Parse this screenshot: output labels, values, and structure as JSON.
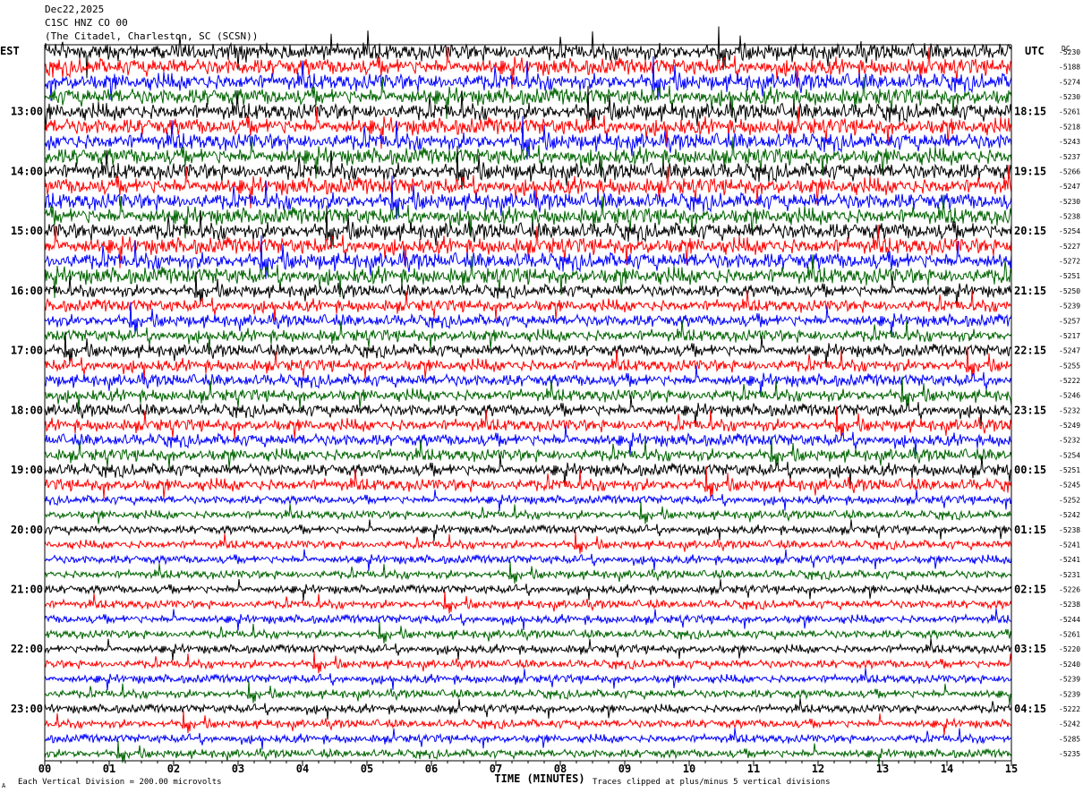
{
  "header": {
    "date": "Dec22,2025",
    "station": "C1SC HNZ CO 00",
    "network": "(The Citadel, Charleston, SC (SCSN))"
  },
  "footer": {
    "scale_note": "Each Vertical Division =  200.00 microvolts",
    "clip_note": "Traces clipped at plus/minus 5 vertical divisions",
    "corner_mark": "A"
  },
  "chart_data": {
    "type": "line",
    "title": "",
    "xlabel": "TIME (MINUTES)",
    "x_ticks": [
      "00",
      "01",
      "02",
      "03",
      "04",
      "05",
      "06",
      "07",
      "08",
      "09",
      "10",
      "11",
      "12",
      "13",
      "14",
      "15"
    ],
    "xlim": [
      0,
      15
    ],
    "left_axis_label": "EST",
    "right_axis_label": "UTC",
    "dc_label": "DC",
    "left_hour_labels": [
      "13:00",
      "14:00",
      "15:00",
      "16:00",
      "17:00",
      "18:00",
      "19:00",
      "20:00",
      "21:00",
      "22:00",
      "23:00"
    ],
    "right_hour_labels": [
      "18:15",
      "19:15",
      "20:15",
      "21:15",
      "22:15",
      "23:15",
      "00:15",
      "01:15",
      "02:15",
      "03:15",
      "04:15"
    ],
    "trace_colors": [
      "#000000",
      "#ff0000",
      "#0000ff",
      "#006400"
    ],
    "dc_offsets": [
      -5230,
      -5188,
      -5274,
      -5230,
      -5261,
      -5218,
      -5243,
      -5237,
      -5266,
      -5247,
      -5230,
      -5238,
      -5254,
      -5227,
      -5272,
      -5251,
      -5250,
      -5239,
      -5257,
      -5217,
      -5247,
      -5255,
      -5222,
      -5246,
      -5232,
      -5249,
      -5232,
      -5254,
      -5251,
      -5245,
      -5252,
      -5242,
      -5238,
      -5241,
      -5241,
      -5231,
      -5226,
      -5238,
      -5244,
      -5261,
      -5220,
      -5240,
      -5239,
      -5239,
      -5222,
      -5242,
      -5285,
      -5235
    ],
    "traces": 48,
    "minutes_per_trace": 15,
    "units_per_division": "200.00 microvolts"
  }
}
